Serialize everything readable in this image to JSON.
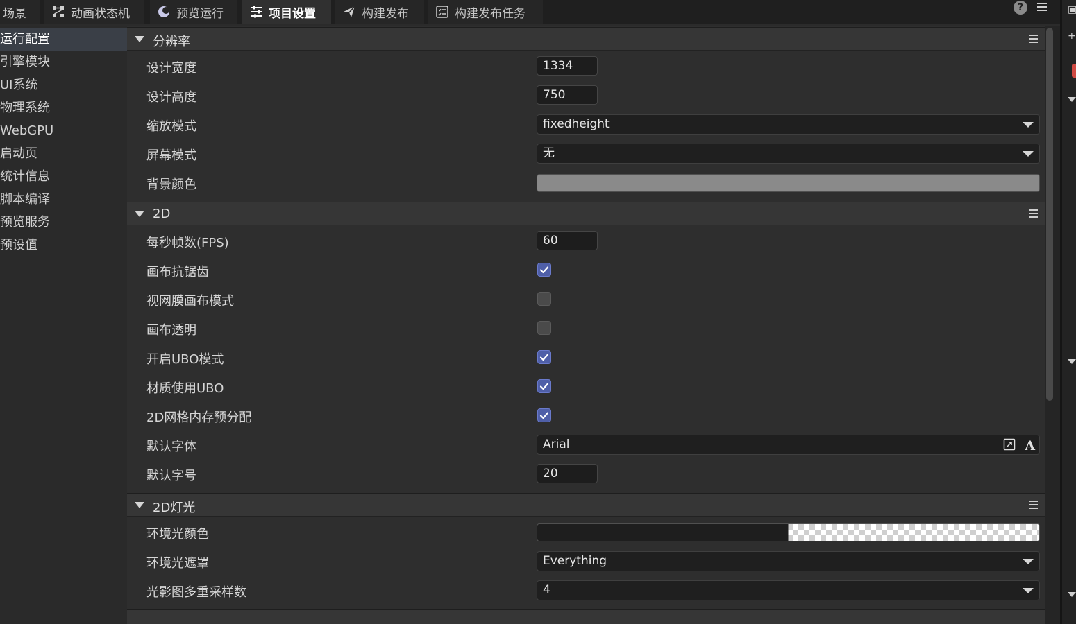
{
  "tabs": [
    {
      "label": "场景",
      "icon": "scene-icon"
    },
    {
      "label": "动画状态机",
      "icon": "state-machine-icon"
    },
    {
      "label": "预览运行",
      "icon": "preview-icon"
    },
    {
      "label": "项目设置",
      "icon": "settings-sliders-icon",
      "active": true
    },
    {
      "label": "构建发布",
      "icon": "send-icon"
    },
    {
      "label": "构建发布任务",
      "icon": "task-list-icon"
    }
  ],
  "help_glyph": "?",
  "sidebar": {
    "items": [
      {
        "label": "运行配置",
        "active": true
      },
      {
        "label": "引擎模块"
      },
      {
        "label": "UI系统"
      },
      {
        "label": "物理系统"
      },
      {
        "label": "WebGPU"
      },
      {
        "label": "启动页"
      },
      {
        "label": "统计信息"
      },
      {
        "label": "脚本编译"
      },
      {
        "label": "预览服务"
      },
      {
        "label": "预设值"
      }
    ]
  },
  "sections": {
    "resolution": {
      "title": "分辨率",
      "design_width": {
        "label": "设计宽度",
        "value": "1334"
      },
      "design_height": {
        "label": "设计高度",
        "value": "750"
      },
      "scale_mode": {
        "label": "缩放模式",
        "value": "fixedheight"
      },
      "screen_mode": {
        "label": "屏幕模式",
        "value": "无"
      },
      "bg_color": {
        "label": "背景颜色",
        "color": "#8a8a8a"
      }
    },
    "two_d": {
      "title": "2D",
      "fps": {
        "label": "每秒帧数(FPS)",
        "value": "60"
      },
      "antialias": {
        "label": "画布抗锯齿",
        "checked": true
      },
      "retina": {
        "label": "视网膜画布模式",
        "checked": false
      },
      "transparent": {
        "label": "画布透明",
        "checked": false
      },
      "ubo_mode": {
        "label": "开启UBO模式",
        "checked": true
      },
      "material_ubo": {
        "label": "材质使用UBO",
        "checked": true
      },
      "mesh_prealloc": {
        "label": "2D网格内存预分配",
        "checked": true
      },
      "default_font": {
        "label": "默认字体",
        "value": "Arial"
      },
      "default_font_size": {
        "label": "默认字号",
        "value": "20"
      }
    },
    "light_2d": {
      "title": "2D灯光",
      "ambient_color": {
        "label": "环境光颜色",
        "color": "#1e1e1e"
      },
      "ambient_mask": {
        "label": "环境光遮罩",
        "value": "Everything"
      },
      "shadow_samples": {
        "label": "光影图多重采样数",
        "value": "4"
      }
    }
  },
  "colors": {
    "accent": "#4f5fa8",
    "background": "#2e2e2e",
    "section_header": "#363636"
  }
}
